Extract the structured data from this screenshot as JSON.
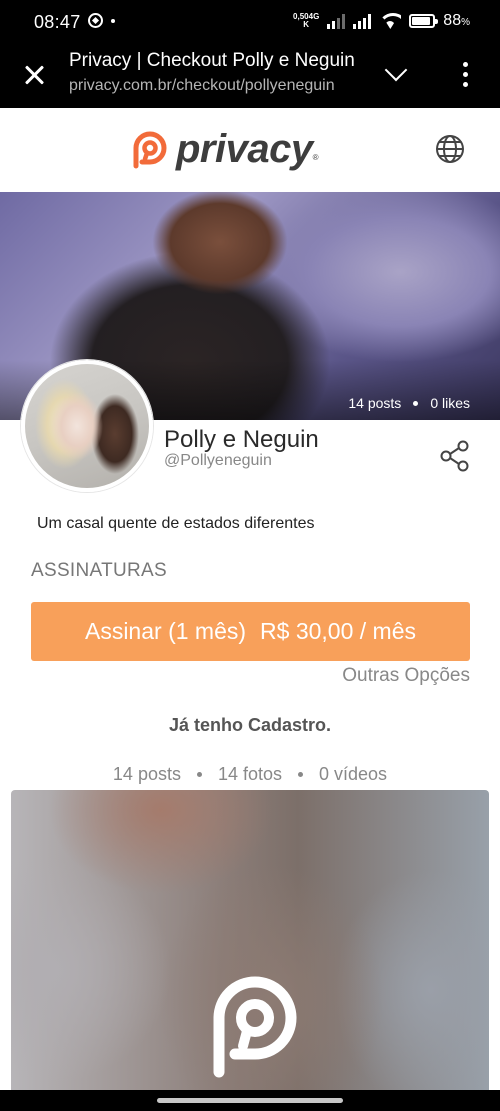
{
  "status_bar": {
    "time": "08:47",
    "net_speed_value": "0,50",
    "net_speed_unit": "K",
    "net_type": "4G",
    "battery_percent": "88",
    "battery_level": 0.88
  },
  "browser": {
    "title": "Privacy | Checkout Polly e Neguin",
    "url": "privacy.com.br/checkout/pollyeneguin"
  },
  "header": {
    "logo_text": "privacy",
    "brand_color": "#f26b3a",
    "language_icon": "globe-icon"
  },
  "cover": {
    "posts": "14 posts",
    "likes": "0 likes"
  },
  "profile": {
    "name": "Polly e Neguin",
    "handle": "@Pollyeneguin",
    "bio": "Um casal quente de estados diferentes",
    "share_icon": "share-icon"
  },
  "subscriptions": {
    "section_label": "ASSINATURAS",
    "plan_label": "Assinar (1 mês)",
    "plan_price": "R$ 30,00 / mês",
    "button_color": "#f8a05a",
    "other_options": "Outras Opções"
  },
  "login_link": "Já tenho Cadastro.",
  "counts": {
    "posts": "14 posts",
    "photos": "14 fotos",
    "videos": "0 vídeos"
  }
}
